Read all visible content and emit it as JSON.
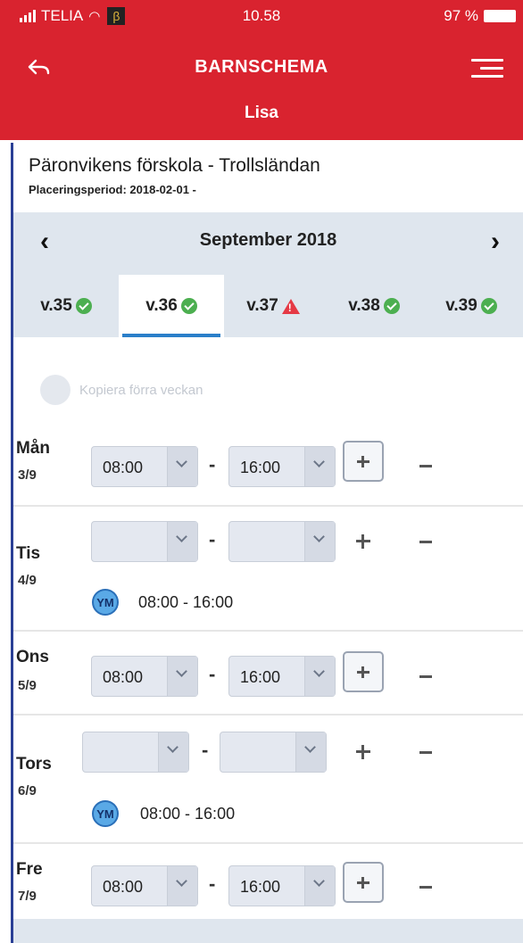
{
  "status_bar": {
    "carrier": "TELIA",
    "beta_glyph": "β",
    "time": "10.58",
    "battery": "97 %"
  },
  "nav": {
    "title": "BARNSCHEMA",
    "child_name": "Lisa",
    "back_icon": "back-arrow-icon",
    "menu_icon": "hamburger-menu-icon"
  },
  "placement": {
    "school": "Päronvikens förskola - Trollsländan",
    "period": "Placeringsperiod: 2018-02-01  -"
  },
  "calendar": {
    "month": "September 2018",
    "weeks": [
      {
        "label": "v.35",
        "status": "ok",
        "active": false
      },
      {
        "label": "v.36",
        "status": "ok",
        "active": true
      },
      {
        "label": "v.37",
        "status": "warning",
        "active": false
      },
      {
        "label": "v.38",
        "status": "ok",
        "active": false
      },
      {
        "label": "v.39",
        "status": "ok",
        "active": false
      }
    ]
  },
  "copy_link": {
    "label": "Kopiera förra veckan"
  },
  "days": [
    {
      "name": "Mån",
      "date": "3/9",
      "from": "08:00",
      "to": "16:00",
      "scheduled": ""
    },
    {
      "name": "Tis",
      "date": "4/9",
      "from": "",
      "to": "",
      "scheduled": "08:00 - 16:00",
      "initials": "YM"
    },
    {
      "name": "Ons",
      "date": "5/9",
      "from": "08:00",
      "to": "16:00",
      "scheduled": ""
    },
    {
      "name": "Tors",
      "date": "6/9",
      "from": "",
      "to": "",
      "scheduled": "08:00 - 16:00",
      "initials": "YM"
    },
    {
      "name": "Fre",
      "date": "7/9",
      "from": "08:00",
      "to": "16:00",
      "scheduled": ""
    }
  ],
  "colors": {
    "header": "#d9232f",
    "accent_blue": "#2a7fc9",
    "ok_green": "#4caf50",
    "warning_red": "#e53945",
    "tab_bg": "#dfe6ee"
  }
}
